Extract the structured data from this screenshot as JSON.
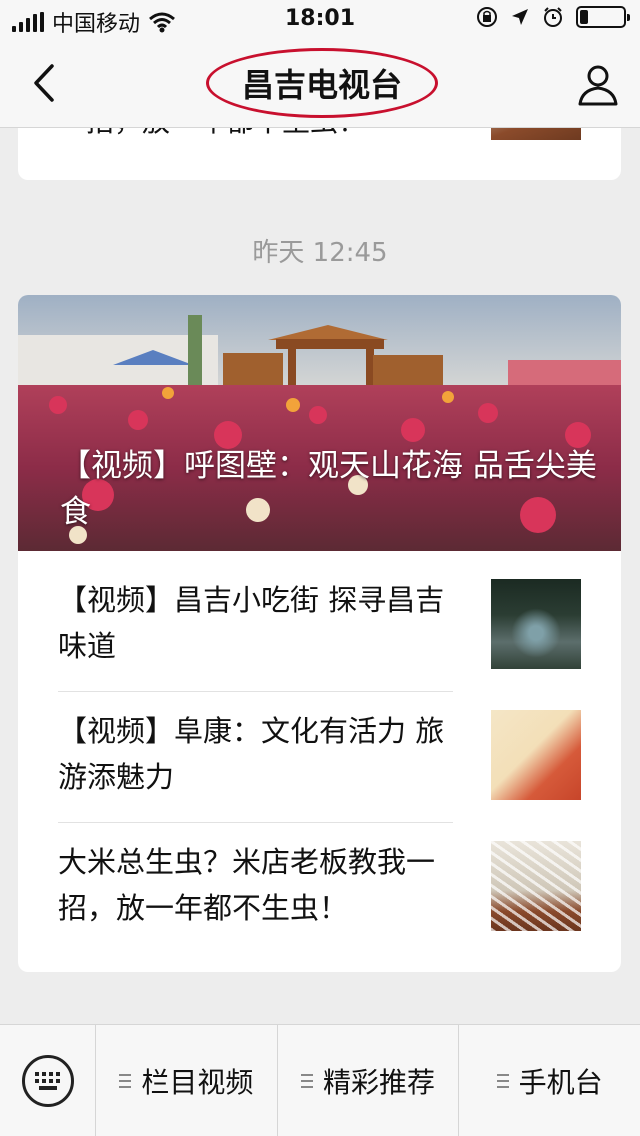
{
  "status_bar": {
    "carrier": "中国移动",
    "time": "18:01"
  },
  "nav": {
    "title": "昌吉电视台"
  },
  "feed": {
    "previous_card": {
      "snippet": "一招，放一年都不生虫！"
    },
    "timestamp": "昨天 12:45",
    "main_card": {
      "hero_title": "【视频】呼图壁：观天山花海 品舌尖美食",
      "items": [
        {
          "title": "【视频】昌吉小吃街 探寻昌吉味道"
        },
        {
          "title": "【视频】阜康：文化有活力 旅游添魅力"
        },
        {
          "title": "大米总生虫？米店老板教我一招，放一年都不生虫！"
        }
      ]
    }
  },
  "bottom_menu": {
    "items": [
      {
        "label": "栏目视频"
      },
      {
        "label": "精彩推荐"
      },
      {
        "label": "手机台"
      }
    ]
  },
  "colors": {
    "highlight_circle": "#c8102e"
  }
}
